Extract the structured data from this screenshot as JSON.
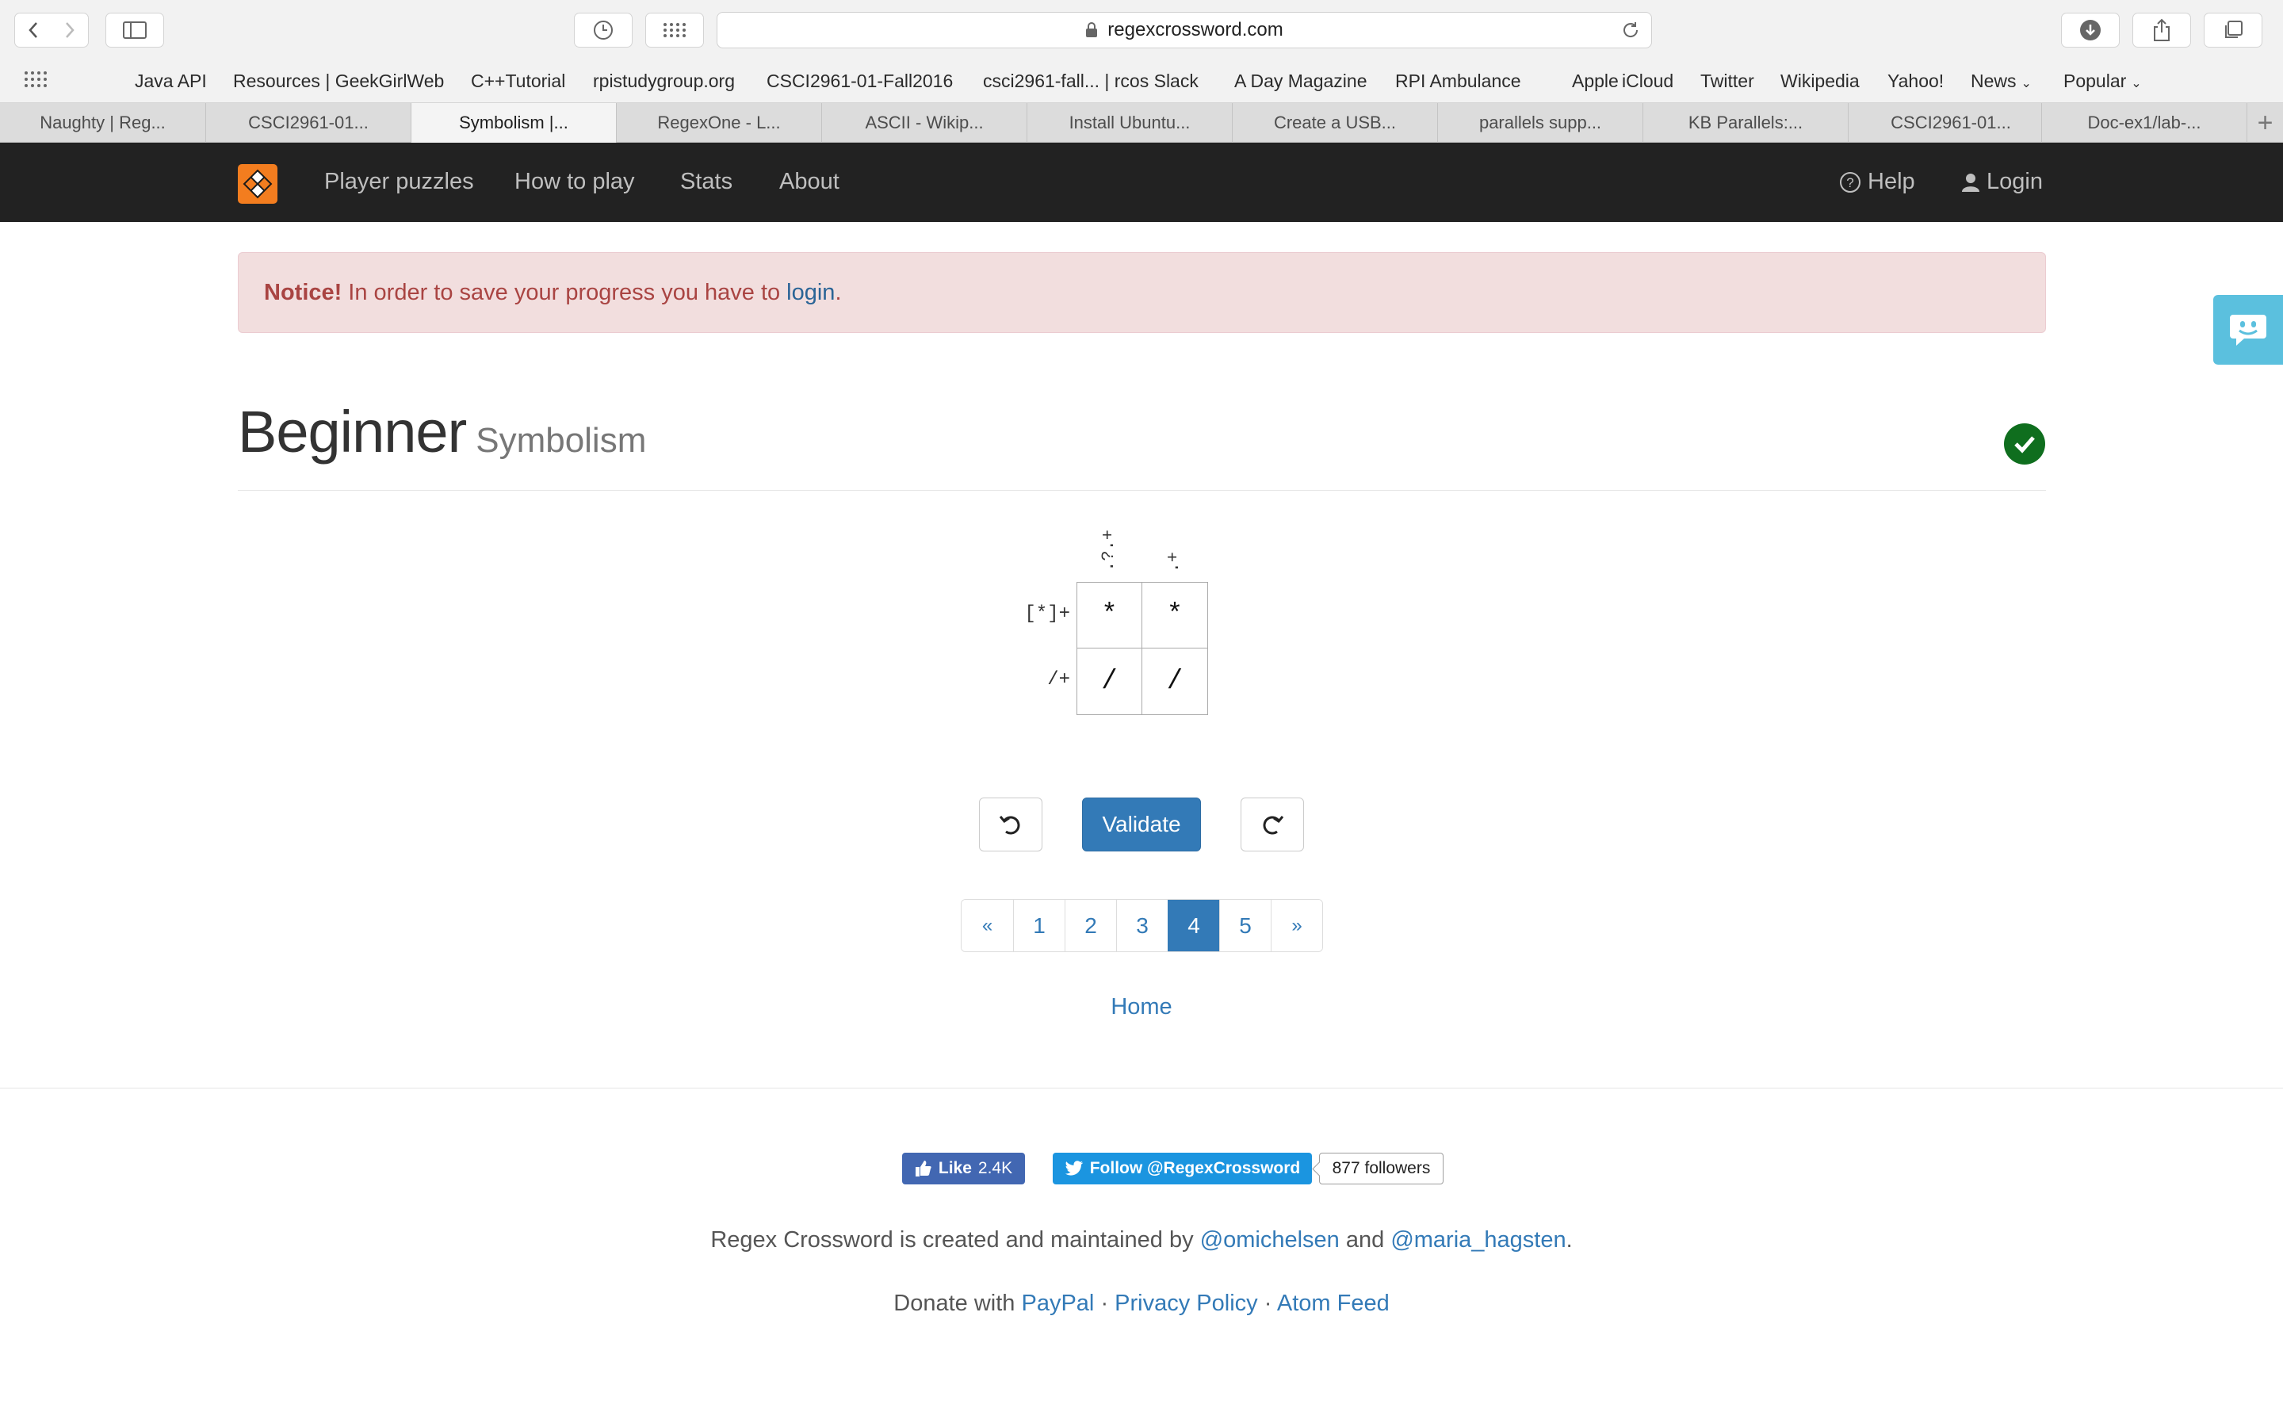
{
  "browser": {
    "url": "regexcrossword.com",
    "bookmarks": [
      "Java API",
      "Resources | GeekGirlWeb",
      "C++Tutorial",
      "rpistudygroup.org",
      "CSCI2961-01-Fall2016",
      "csci2961-fall... | rcos Slack",
      "A Day Magazine",
      "RPI Ambulance",
      "Apple",
      "iCloud",
      "Twitter",
      "Wikipedia",
      "Yahoo!",
      "News",
      "Popular"
    ],
    "tabs": [
      "Naughty | Reg...",
      "CSCI2961-01...",
      "Symbolism |...",
      "RegexOne - L...",
      "ASCII - Wikip...",
      "Install Ubuntu...",
      "Create a USB...",
      "parallels supp...",
      "KB Parallels:...",
      "CSCI2961-01...",
      "Doc-ex1/lab-..."
    ],
    "active_tab_index": 2
  },
  "nav": {
    "links": [
      "Player puzzles",
      "How to play",
      "Stats",
      "About"
    ],
    "help": "Help",
    "login": "Login"
  },
  "alert": {
    "strong": "Notice!",
    "text": "In order to save your progress you have to",
    "link": "login",
    "end": "."
  },
  "puzzle": {
    "title": "Beginner",
    "subtitle": "Symbolism",
    "solved": true,
    "column_clues": [
      ".?.+",
      ".+"
    ],
    "row_clues": [
      "[*]+",
      "/+"
    ],
    "grid": [
      [
        "*",
        "*"
      ],
      [
        "/",
        "/"
      ]
    ]
  },
  "controls": {
    "validate": "Validate",
    "undo_icon": "undo-icon",
    "redo_icon": "redo-icon"
  },
  "pagination": {
    "prev": "«",
    "pages": [
      "1",
      "2",
      "3",
      "4",
      "5"
    ],
    "active": "4",
    "next": "»"
  },
  "home_link": "Home",
  "footer": {
    "fb_like": "Like",
    "fb_count": "2.4K",
    "twitter_follow": "Follow @RegexCrossword",
    "twitter_count": "877 followers",
    "credits_prefix": "Regex Crossword is created and maintained by",
    "author1": "@omichelsen",
    "credits_and": "and",
    "author2": "@maria_hagsten",
    "credits_end": ".",
    "donate_prefix": "Donate with",
    "paypal": "PayPal",
    "privacy": "Privacy Policy",
    "atom": "Atom Feed",
    "separator": "·"
  },
  "colors": {
    "navbar": "#222222",
    "logo": "#f37d1f",
    "primary": "#337ab7",
    "alert_bg": "#f2dede",
    "alert_text": "#a94442",
    "success": "#0f6e1e"
  }
}
